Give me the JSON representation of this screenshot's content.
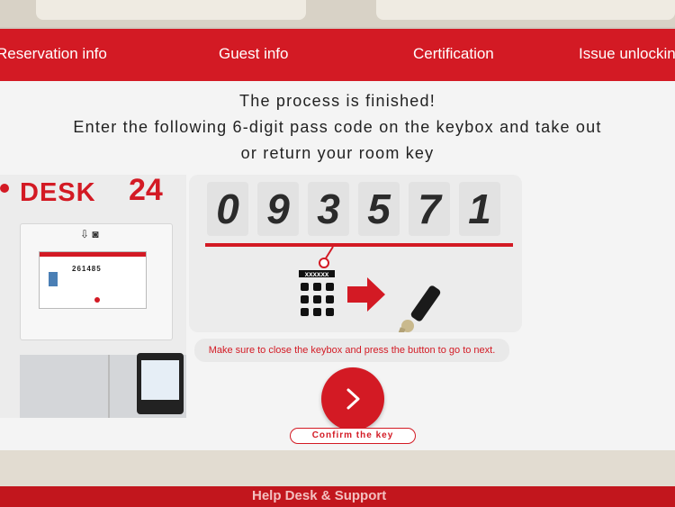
{
  "nav": {
    "steps": [
      "Reservation info",
      "Guest info",
      "Certification",
      "Issue unlockin"
    ]
  },
  "message": {
    "line1": "The process is finished!",
    "line2": "Enter the following 6-digit pass code on the keybox and take out",
    "line3": "or return your room key"
  },
  "photo": {
    "brand": "DESK",
    "brand_num": "24",
    "panel_code": "261485"
  },
  "passcode": {
    "digits": [
      "0",
      "9",
      "3",
      "5",
      "7",
      "1"
    ],
    "keypad_label": "xxxxxx"
  },
  "notice": "Make sure to close the keybox and press the button to go to next.",
  "confirm": {
    "label": "Confirm the key"
  },
  "bezel": {
    "caption": "Help Desk & Support"
  },
  "colors": {
    "accent": "#d31a24",
    "screen_bg": "#f4f4f4"
  }
}
